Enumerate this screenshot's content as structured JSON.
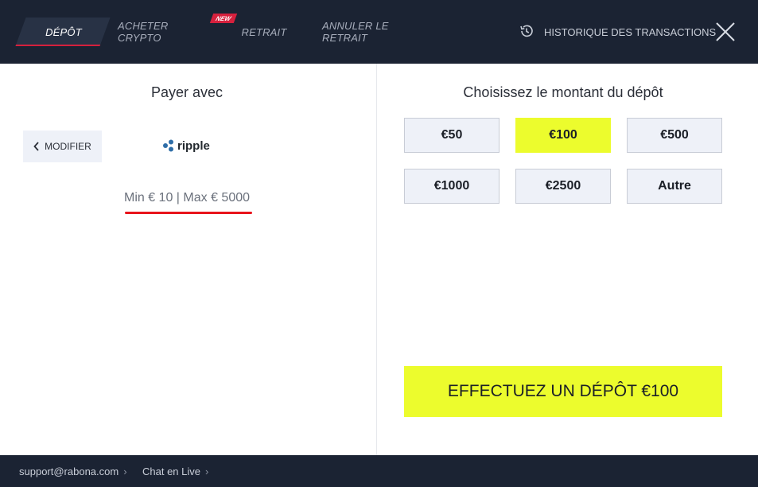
{
  "nav": {
    "tabs": [
      {
        "label": "DÉPÔT",
        "active": true
      },
      {
        "label": "ACHETER CRYPTO",
        "badge": "NEW"
      },
      {
        "label": "RETRAIT"
      },
      {
        "label": "ANNULER LE RETRAIT"
      }
    ],
    "history_label": "HISTORIQUE DES TRANSACTIONS",
    "history_icon": "history-clock-icon",
    "close_icon": "close-icon"
  },
  "payment": {
    "title": "Payer avec",
    "modify_label": "MODIFIER",
    "method_name": "ripple",
    "limits": "Min € 10 | Max € 5000"
  },
  "amount": {
    "title": "Choisissez le montant du dépôt",
    "options": [
      "€50",
      "€100",
      "€500",
      "€1000",
      "€2500",
      "Autre"
    ],
    "selected": "€100",
    "cta_label": "EFFECTUEZ UN DÉPÔT €100"
  },
  "footer": {
    "links": [
      "support@rabona.com",
      "Chat en Live"
    ]
  },
  "colors": {
    "nav_bg": "#1b2333",
    "accent_red": "#d6203d",
    "accent_yellow": "#ecfc2d",
    "option_bg": "#eef1f8"
  }
}
